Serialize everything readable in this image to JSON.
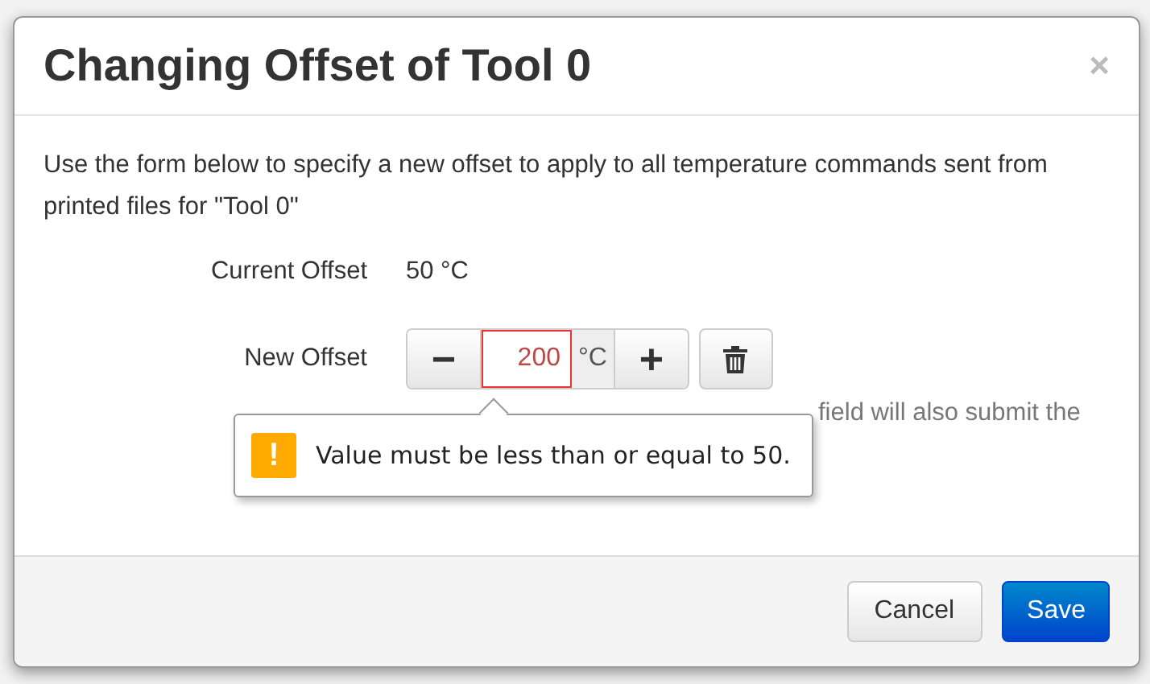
{
  "dialog": {
    "title": "Changing Offset of Tool 0",
    "close": "×",
    "description": "Use the form below to specify a new offset to apply to all temperature commands sent from printed files for \"Tool 0\"",
    "current_offset": {
      "label": "Current Offset",
      "value": "50 °C"
    },
    "new_offset": {
      "label": "New Offset",
      "decrement": "−",
      "value": "200",
      "unit": "°C",
      "increment": "+",
      "invalid": true,
      "hint": "field will also submit the"
    },
    "validation": {
      "icon": "!",
      "message": "Value must be less than or equal to 50."
    },
    "buttons": [
      {
        "label": "Cancel",
        "kind": "default"
      },
      {
        "label": "Save",
        "kind": "primary"
      }
    ]
  }
}
